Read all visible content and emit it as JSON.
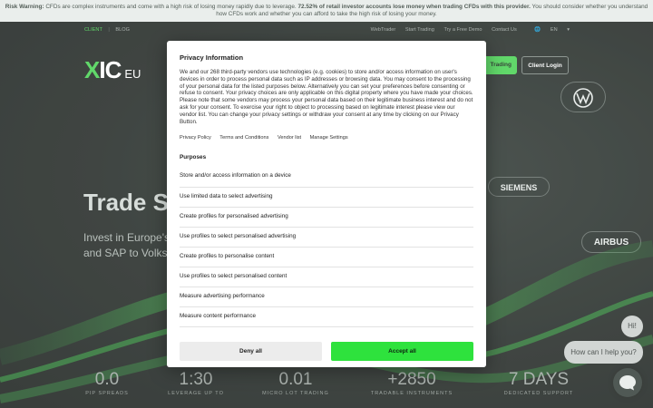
{
  "risk_banner": {
    "label": "Risk Warning:",
    "text1": "CFDs are complex instruments and come with a high risk of losing money rapidly due to leverage.",
    "emph": "72.52% of retail investor accounts lose money when trading CFDs with this provider.",
    "text2": "You should consider whether you understand how CFDs work and whether you can afford to take the high risk of losing your money."
  },
  "topnav": {
    "client": "CLIENT",
    "blog": "BLOG",
    "links": [
      "WebTrader",
      "Start Trading",
      "Try a Free Demo",
      "Contact Us"
    ],
    "language": "EN"
  },
  "header": {
    "logo_x": "X",
    "logo_ic": "IC",
    "logo_region": "EU",
    "start_label": "Trading",
    "login_label": "Client Login"
  },
  "hero": {
    "title": "Trade S",
    "sub1": "Invest in Europe's m",
    "sub2": "and SAP to Volksw"
  },
  "brands": {
    "siemens": "SIEMENS",
    "airbus": "AIRBUS",
    "vw": "VW"
  },
  "stats": [
    {
      "value": "0.0",
      "label": "PIP SPREADS"
    },
    {
      "value": "1:30",
      "label": "LEVERAGE UP TO"
    },
    {
      "value": "0.01",
      "label": "MICRO LOT TRADING"
    },
    {
      "value": "+2850",
      "label": "TRADABLE INSTRUMENTS"
    },
    {
      "value": "7 DAYS",
      "label": "DEDICATED SUPPORT"
    }
  ],
  "chat": {
    "hi": "Hi!",
    "help": "How can I help you?"
  },
  "modal": {
    "title": "Privacy Information",
    "body": "We and our 268 third-party vendors use technologies (e.g. cookies) to store and/or access information on user's devices in order to process personal data such as IP addresses or browsing data. You may consent to the processing of your personal data for the listed purposes below. Alternatively you can set your preferences before consenting or refuse to consent. Your privacy choices are only applicable on this digital property where you have made your choices. Please note that some vendors may process your personal data based on their legitimate business interest and do not ask for your consent. To exercise your right to object to processing based on legitimate interest please view our vendor list. You can change your privacy settings or withdraw your consent at any time by clicking on our Privacy Button.",
    "links": [
      "Privacy Policy",
      "Terms and Conditions",
      "Vendor list",
      "Manage Settings"
    ],
    "purposes_heading": "Purposes",
    "purposes": [
      "Store and/or access information on a device",
      "Use limited data to select advertising",
      "Create profiles for personalised advertising",
      "Use profiles to select personalised advertising",
      "Create profiles to personalise content",
      "Use profiles to select personalised content",
      "Measure advertising performance",
      "Measure content performance"
    ],
    "deny_label": "Deny all",
    "accept_label": "Accept all"
  },
  "colors": {
    "accent": "#2ee23d",
    "brand_green": "#3fd04a",
    "background": "#0e1512"
  }
}
